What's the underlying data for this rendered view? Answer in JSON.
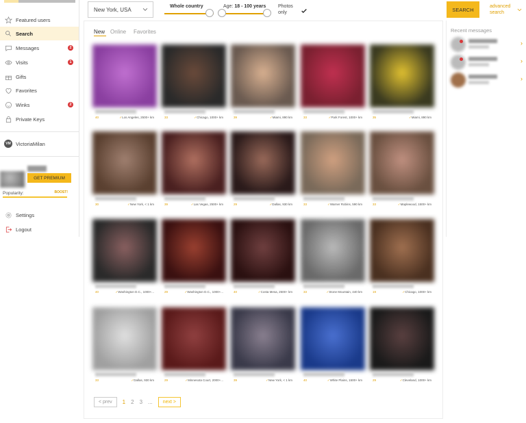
{
  "sidebar": {
    "items": [
      {
        "label": "Featured users",
        "icon": "star-icon"
      },
      {
        "label": "Search",
        "icon": "search-icon"
      },
      {
        "label": "Messages",
        "icon": "chat-icon",
        "badge": "2"
      },
      {
        "label": "Visits",
        "icon": "eye-icon",
        "badge": "1"
      },
      {
        "label": "Gifts",
        "icon": "gift-icon"
      },
      {
        "label": "Favorites",
        "icon": "heart-icon"
      },
      {
        "label": "Winks",
        "icon": "smile-icon",
        "badge": "2"
      },
      {
        "label": "Private Keys",
        "icon": "lock-icon"
      }
    ],
    "account_initials": "VM",
    "account_name": "VictoriaMilan",
    "premium_label": "GET PREMIUM",
    "popularity_label": "Popularity:",
    "boost_label": "BOOST!",
    "settings_label": "Settings",
    "logout_label": "Logout"
  },
  "topbar": {
    "location": "New York, USA",
    "whole_country": "Whole country",
    "age_prefix": "Age:",
    "age_range": "18 - 100 years",
    "photos_only": "Photos only",
    "photos_checked": true,
    "search_label": "SEARCH",
    "advanced_search": "advanced search"
  },
  "tabs": [
    "New",
    "Online",
    "Favorites"
  ],
  "profiles": [
    {
      "age": "40",
      "location": "Los Angeles, 2500+ km"
    },
    {
      "age": "33",
      "location": "Chicago, 1000+ km"
    },
    {
      "age": "39",
      "location": "Miami, 890 km"
    },
    {
      "age": "33",
      "location": "Park Forest, 1000+ km"
    },
    {
      "age": "35",
      "location": "Miami, 890 km"
    },
    {
      "age": "30",
      "location": "New York, < 1 km"
    },
    {
      "age": "39",
      "location": "Las Vegas, 2500+ km"
    },
    {
      "age": "29",
      "location": "Dallas, 930 km"
    },
    {
      "age": "33",
      "location": "Warner Robins, 590 km"
    },
    {
      "age": "33",
      "location": "Maplewood, 1500+ km"
    },
    {
      "age": "40",
      "location": "Washington D.C., 1000+..."
    },
    {
      "age": "29",
      "location": "Washington D.C., 1000+..."
    },
    {
      "age": "40",
      "location": "Costa Mesa, 2500+ km"
    },
    {
      "age": "33",
      "location": "Stone Mountain, 440 km"
    },
    {
      "age": "19",
      "location": "Chicago, 1000+ km"
    },
    {
      "age": "33",
      "location": "Dallas, 930 km"
    },
    {
      "age": "29",
      "location": "Minnesota Court, 2000+..."
    },
    {
      "age": "39",
      "location": "New York, < 1 km"
    },
    {
      "age": "40",
      "location": "White Plains, 1500+ km"
    },
    {
      "age": "29",
      "location": "Cleveland, 1000+ km"
    }
  ],
  "pagination": {
    "prev": "< prev",
    "pages": [
      "1",
      "2",
      "3",
      "..."
    ],
    "next": "next >"
  },
  "recent_messages": {
    "title": "Recent messages"
  },
  "colors": {
    "accent": "#f4b81c",
    "badge": "#d9383a"
  }
}
